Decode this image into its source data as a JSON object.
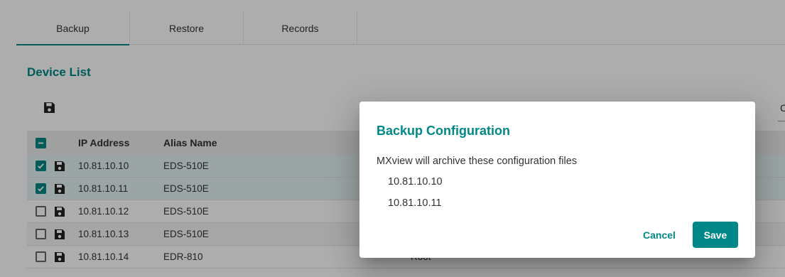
{
  "tabs": [
    {
      "label": "Backup",
      "active": true
    },
    {
      "label": "Restore",
      "active": false
    },
    {
      "label": "Records",
      "active": false
    }
  ],
  "device_list": {
    "title": "Device List",
    "search_hint_char": "C",
    "columns": [
      "IP Address",
      "Alias Name"
    ],
    "rows": [
      {
        "ip": "10.81.10.10",
        "alias": "EDS-510E",
        "checked": true,
        "extra": ""
      },
      {
        "ip": "10.81.10.11",
        "alias": "EDS-510E",
        "checked": true,
        "extra": ""
      },
      {
        "ip": "10.81.10.12",
        "alias": "EDS-510E",
        "checked": false,
        "extra": ""
      },
      {
        "ip": "10.81.10.13",
        "alias": "EDS-510E",
        "checked": false,
        "extra": ""
      },
      {
        "ip": "10.81.10.14",
        "alias": "EDR-810",
        "checked": false,
        "extra": "Root"
      }
    ]
  },
  "dialog": {
    "title": "Backup Configuration",
    "message": "MXview will archive these configuration files",
    "files": [
      "10.81.10.10",
      "10.81.10.11"
    ],
    "cancel_label": "Cancel",
    "save_label": "Save"
  },
  "colors": {
    "accent": "#008787",
    "overlay": "rgba(0,0,0,0.32)"
  },
  "icons": {
    "save": "floppy-disk-icon",
    "check": "check-icon",
    "indeterminate": "minus-icon"
  }
}
